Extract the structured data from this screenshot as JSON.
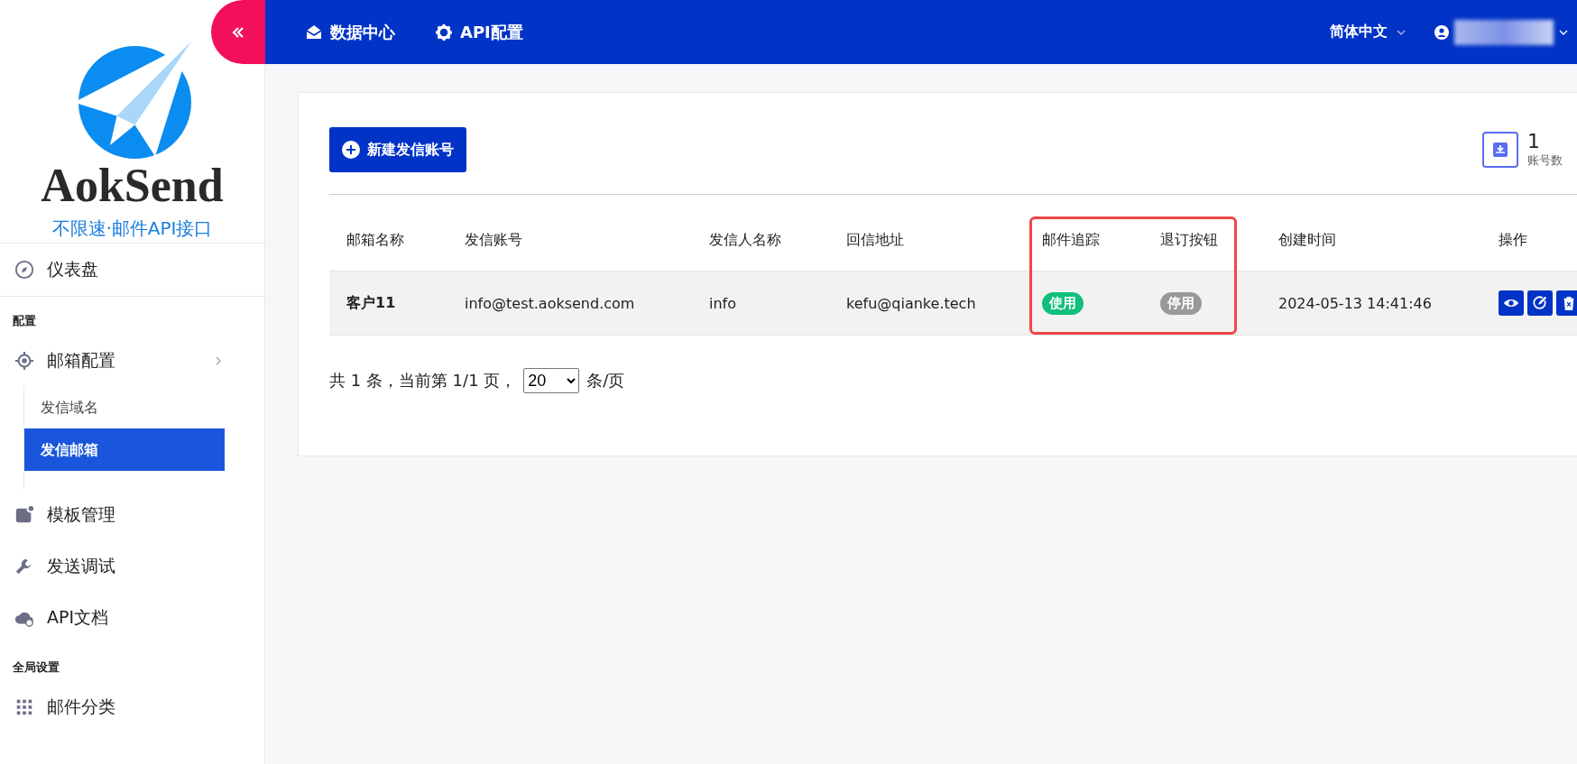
{
  "logo": {
    "name": "AokSend",
    "tagline": "不限速·邮件API接口"
  },
  "sidebar": {
    "items": [
      {
        "kind": "item",
        "label": "仪表盘",
        "selected": false
      },
      {
        "kind": "section",
        "label": "配置"
      },
      {
        "kind": "group",
        "label": "邮箱配置",
        "children": [
          {
            "label": "发信域名",
            "selected": false
          },
          {
            "label": "发信邮箱",
            "selected": true
          }
        ]
      },
      {
        "kind": "item",
        "label": "模板管理",
        "selected": false
      },
      {
        "kind": "item",
        "label": "发送调试",
        "selected": false
      },
      {
        "kind": "item",
        "label": "API文档",
        "selected": false
      },
      {
        "kind": "section",
        "label": "全局设置"
      },
      {
        "kind": "item",
        "label": "邮件分类",
        "selected": false
      }
    ]
  },
  "topbar": {
    "nav": [
      "数据中心",
      "API配置"
    ],
    "language": "简体中文"
  },
  "toolbar": {
    "new_button": "新建发信账号",
    "stat": {
      "value": "1",
      "label": "账号数"
    }
  },
  "table": {
    "columns": [
      "邮箱名称",
      "发信账号",
      "发信人名称",
      "回信地址",
      "邮件追踪",
      "退订按钮",
      "创建时间",
      "操作"
    ],
    "rows": [
      {
        "name": "客户11",
        "account": "info@test.aoksend.com",
        "sender": "info",
        "reply_to": "kefu@qianke.tech",
        "tracking": {
          "label": "使用",
          "on": true
        },
        "unsubscribe": {
          "label": "停用",
          "on": false
        },
        "created": "2024-05-13 14:41:46"
      }
    ]
  },
  "pagination": {
    "summary": "共 1 条，当前第 1/1 页，",
    "page_size": "20",
    "unit": "条/页"
  }
}
